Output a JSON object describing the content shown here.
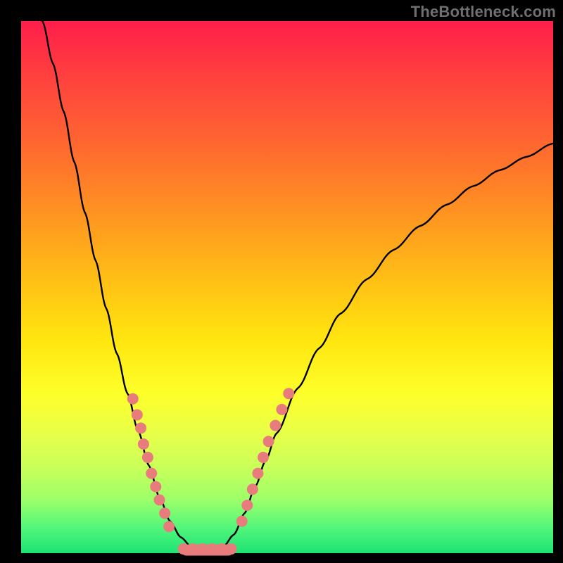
{
  "watermark": "TheBottleneck.com",
  "chart_data": {
    "type": "line",
    "title": "",
    "xlabel": "",
    "ylabel": "",
    "xlim": [
      0,
      100
    ],
    "ylim": [
      0,
      100
    ],
    "grid": false,
    "legend": false,
    "series": [
      {
        "name": "curve",
        "color": "#000000",
        "points": [
          {
            "x": 4.0,
            "y": 100.0
          },
          {
            "x": 6.0,
            "y": 92.0
          },
          {
            "x": 8.0,
            "y": 83.0
          },
          {
            "x": 10.0,
            "y": 73.5
          },
          {
            "x": 12.0,
            "y": 64.0
          },
          {
            "x": 14.0,
            "y": 55.0
          },
          {
            "x": 16.0,
            "y": 46.0
          },
          {
            "x": 18.0,
            "y": 37.5
          },
          {
            "x": 20.0,
            "y": 30.0
          },
          {
            "x": 22.0,
            "y": 23.0
          },
          {
            "x": 24.0,
            "y": 16.5
          },
          {
            "x": 26.0,
            "y": 10.5
          },
          {
            "x": 28.0,
            "y": 6.0
          },
          {
            "x": 30.0,
            "y": 3.0
          },
          {
            "x": 32.0,
            "y": 1.2
          },
          {
            "x": 34.0,
            "y": 0.6
          },
          {
            "x": 36.0,
            "y": 0.6
          },
          {
            "x": 38.0,
            "y": 1.2
          },
          {
            "x": 40.0,
            "y": 3.5
          },
          {
            "x": 42.0,
            "y": 7.5
          },
          {
            "x": 44.0,
            "y": 12.5
          },
          {
            "x": 46.0,
            "y": 17.5
          },
          {
            "x": 48.0,
            "y": 22.5
          },
          {
            "x": 52.0,
            "y": 31.0
          },
          {
            "x": 56.0,
            "y": 38.5
          },
          {
            "x": 60.0,
            "y": 45.0
          },
          {
            "x": 65.0,
            "y": 51.5
          },
          {
            "x": 70.0,
            "y": 57.0
          },
          {
            "x": 75.0,
            "y": 61.5
          },
          {
            "x": 80.0,
            "y": 65.5
          },
          {
            "x": 85.0,
            "y": 69.0
          },
          {
            "x": 90.0,
            "y": 72.0
          },
          {
            "x": 95.0,
            "y": 74.5
          },
          {
            "x": 100.0,
            "y": 77.0
          }
        ],
        "bottom_flat": {
          "x_start": 30.0,
          "x_end": 40.0,
          "y": 0.6
        }
      }
    ],
    "marker_clusters": [
      {
        "name": "left-cluster",
        "color": "#e87b7b",
        "points": [
          {
            "x": 21.0,
            "y": 29.0
          },
          {
            "x": 21.8,
            "y": 26.0
          },
          {
            "x": 22.5,
            "y": 23.5
          },
          {
            "x": 23.0,
            "y": 20.5
          },
          {
            "x": 23.8,
            "y": 18.0
          },
          {
            "x": 24.5,
            "y": 15.0
          },
          {
            "x": 25.3,
            "y": 12.5
          },
          {
            "x": 26.0,
            "y": 10.0
          },
          {
            "x": 27.0,
            "y": 7.5
          },
          {
            "x": 27.8,
            "y": 5.0
          }
        ]
      },
      {
        "name": "right-cluster",
        "color": "#e87b7b",
        "points": [
          {
            "x": 41.5,
            "y": 6.0
          },
          {
            "x": 42.5,
            "y": 9.0
          },
          {
            "x": 43.5,
            "y": 12.0
          },
          {
            "x": 44.5,
            "y": 15.0
          },
          {
            "x": 45.5,
            "y": 18.0
          },
          {
            "x": 46.5,
            "y": 21.0
          },
          {
            "x": 47.8,
            "y": 24.0
          },
          {
            "x": 49.0,
            "y": 27.0
          },
          {
            "x": 50.3,
            "y": 30.0
          }
        ]
      },
      {
        "name": "bottom-row",
        "color": "#e87b7b",
        "points": [
          {
            "x": 30.5,
            "y": 0.8
          },
          {
            "x": 32.3,
            "y": 0.8
          },
          {
            "x": 34.1,
            "y": 0.8
          },
          {
            "x": 35.9,
            "y": 0.8
          },
          {
            "x": 37.7,
            "y": 0.8
          },
          {
            "x": 39.5,
            "y": 0.8
          }
        ]
      }
    ]
  }
}
